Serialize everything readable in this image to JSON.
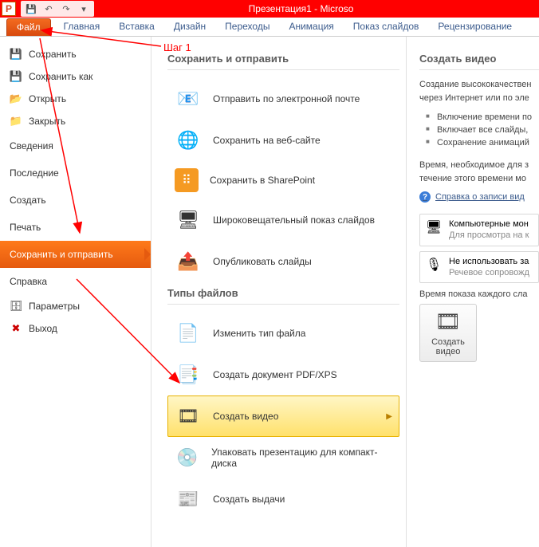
{
  "title": "Презентация1 - Microso",
  "annotation": {
    "step1": "Шаг 1"
  },
  "ribbon": {
    "file": "Файл",
    "tabs": [
      "Главная",
      "Вставка",
      "Дизайн",
      "Переходы",
      "Анимация",
      "Показ слайдов",
      "Рецензирование"
    ]
  },
  "left": {
    "save": "Сохранить",
    "save_as": "Сохранить как",
    "open": "Открыть",
    "close": "Закрыть",
    "info": "Сведения",
    "recent": "Последние",
    "new": "Создать",
    "print": "Печать",
    "save_send": "Сохранить и отправить",
    "help": "Справка",
    "options": "Параметры",
    "exit": "Выход"
  },
  "mid": {
    "h1": "Сохранить и отправить",
    "email": "Отправить по электронной почте",
    "web": "Сохранить на веб-сайте",
    "sharepoint": "Сохранить в SharePoint",
    "broadcast": "Широковещательный показ слайдов",
    "publish": "Опубликовать слайды",
    "h2": "Типы файлов",
    "changetype": "Изменить тип файла",
    "pdfxps": "Создать документ PDF/XPS",
    "video": "Создать видео",
    "packcd": "Упаковать презентацию для компакт-диска",
    "handouts": "Создать выдачи"
  },
  "right": {
    "heading": "Создать видео",
    "desc": "Создание высококачествен через Интернет или по эле",
    "b1": "Включение времени по",
    "b2": "Включает все слайды,",
    "b3": "Сохранение анимаций",
    "note": "Время, необходимое для з течение этого времени мо",
    "help": "Справка о записи вид",
    "combo1_title": "Компьютерные мон",
    "combo1_sub": "Для просмотра на к",
    "combo2_title": "Не использовать за",
    "combo2_sub": "Речевое сопровожд",
    "timing_label": "Время показа каждого сла",
    "button": "Создать видео"
  }
}
